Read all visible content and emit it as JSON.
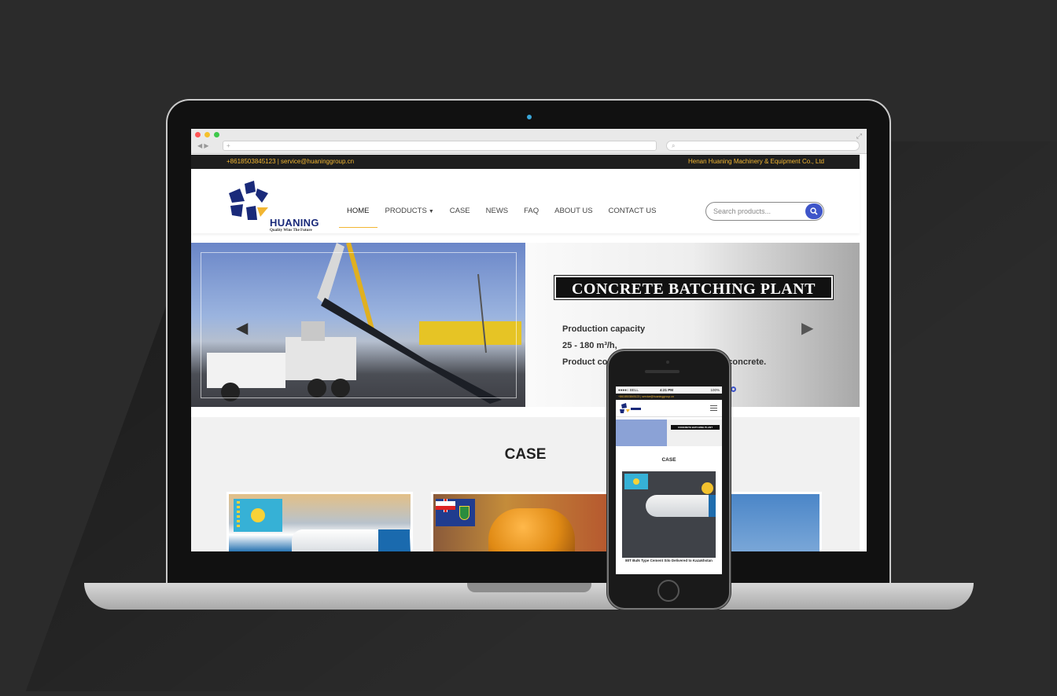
{
  "browser": {
    "url": "+",
    "search": ""
  },
  "topbar": {
    "contact": "+8618503845123  |  service@huaninggroup.cn",
    "company": "Henan Huaning Machinery & Equipment Co., Ltd"
  },
  "logo": {
    "name": "HUANING",
    "tagline": "Quality Wins The Future",
    "colors": {
      "primary": "#1a2a7a",
      "accent": "#f2b632"
    }
  },
  "nav": [
    {
      "label": "HOME",
      "active": true
    },
    {
      "label": "PRODUCTS",
      "dropdown": true
    },
    {
      "label": "CASE"
    },
    {
      "label": "NEWS"
    },
    {
      "label": "FAQ"
    },
    {
      "label": "ABOUT US"
    },
    {
      "label": "CONTACT US"
    }
  ],
  "search": {
    "placeholder": "Search products..."
  },
  "hero": {
    "title": "CONCRETE BATCHING PLANT",
    "line1": "Production capacity",
    "line2": "25 - 180 m³/h,",
    "line3": "Product co",
    "line3_tail": "st concrete."
  },
  "case": {
    "title": "CASE",
    "cards": [
      {
        "flag": "kazakhstan"
      },
      {
        "flag": "british-virgin-islands"
      },
      {
        "flag": "none"
      }
    ]
  },
  "phone": {
    "carrier": "●●●●○ BELL",
    "time": "4:21 PM",
    "battery": "100%",
    "strip": "+8618503845123  |  service@huaninggroup.cn",
    "hero_title": "CONCRETE BATCHING PLANT",
    "case_title": "CASE",
    "card_caption": "80T Bulk Type Cement Silo Delivered to Kazakhstan"
  }
}
